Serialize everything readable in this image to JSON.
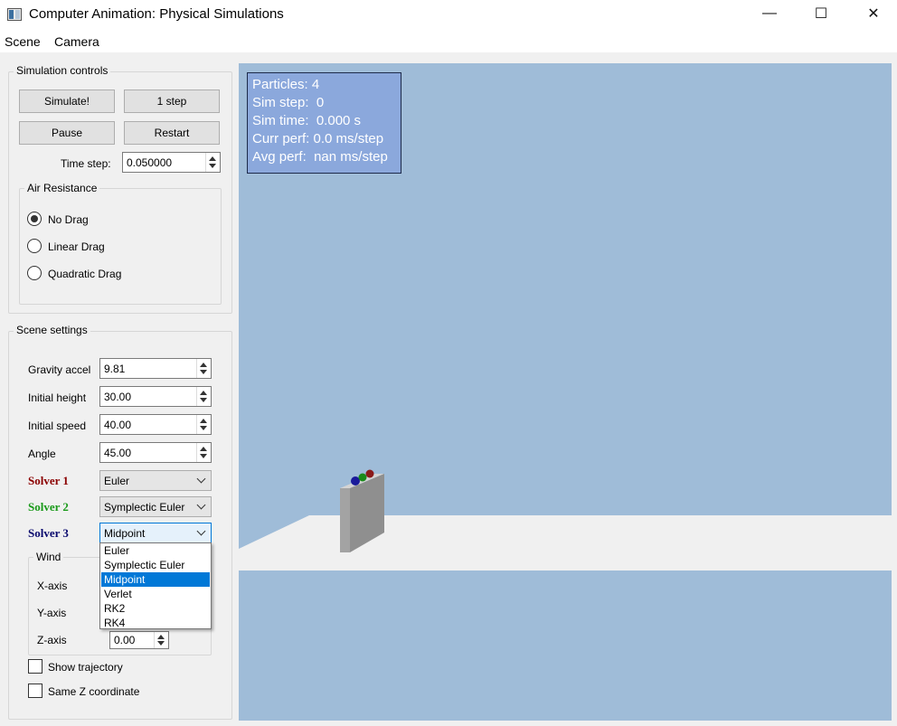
{
  "window": {
    "title": "Computer Animation: Physical Simulations",
    "controls": {
      "minimize": "—",
      "maximize": "☐",
      "close": "✕"
    }
  },
  "menu": [
    "Scene",
    "Camera"
  ],
  "simulation_controls": {
    "title": "Simulation controls",
    "buttons": {
      "simulate": "Simulate!",
      "one_step": "1 step",
      "pause": "Pause",
      "restart": "Restart"
    },
    "time_step": {
      "label": "Time step:",
      "value": "0.050000"
    }
  },
  "air_resistance": {
    "title": "Air Resistance",
    "options": [
      {
        "label": "No Drag",
        "selected": true
      },
      {
        "label": "Linear Drag",
        "selected": false
      },
      {
        "label": "Quadratic Drag",
        "selected": false
      }
    ]
  },
  "scene_settings": {
    "title": "Scene settings",
    "gravity": {
      "label": "Gravity accel",
      "value": "9.81"
    },
    "initial_height": {
      "label": "Initial height",
      "value": "30.00"
    },
    "initial_speed": {
      "label": "Initial speed",
      "value": "40.00"
    },
    "angle": {
      "label": "Angle",
      "value": "45.00"
    },
    "solver1": {
      "label": "Solver 1",
      "value": "Euler",
      "color": "#8b0000"
    },
    "solver2": {
      "label": "Solver 2",
      "value": "Symplectic Euler",
      "color": "#1a9a1a"
    },
    "solver3": {
      "label": "Solver 3",
      "value": "Midpoint",
      "color": "#0a0a6e"
    },
    "solver_options": [
      "Euler",
      "Symplectic Euler",
      "Midpoint",
      "Verlet",
      "RK2",
      "RK4"
    ],
    "wind": {
      "title": "Wind",
      "x_label": "X-axis",
      "y_label": "Y-axis",
      "z_label": "Z-axis",
      "z_value": "0.00"
    },
    "show_trajectory": {
      "label": "Show trajectory",
      "checked": false
    },
    "same_z": {
      "label": "Same Z coordinate",
      "checked": false
    }
  },
  "hud": {
    "particles": "Particles: 4",
    "sim_step": "Sim step:  0",
    "sim_time": "Sim time:  0.000 s",
    "curr_perf": "Curr perf: 0.0 ms/step",
    "avg_perf": "Avg perf:  nan ms/step"
  },
  "colors": {
    "sky": "#9fbcd8",
    "ground": "#f0f0f0",
    "hud_bg": "#8ba8dc",
    "tower": "#9a9a9a",
    "particle_blue": "#1a1a9a",
    "particle_green": "#1a8a1a",
    "particle_red": "#8a1a1a",
    "selection": "#0078d7"
  }
}
